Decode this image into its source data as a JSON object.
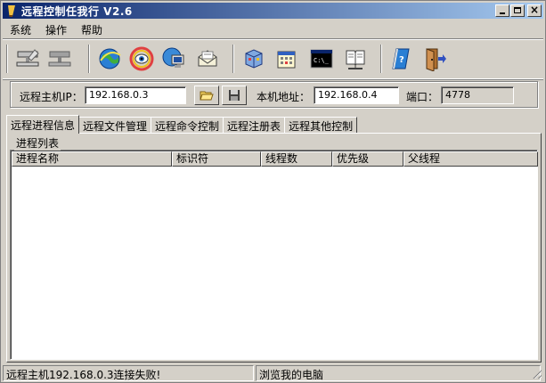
{
  "window": {
    "title": "远程控制任我行  V2.6"
  },
  "menu": [
    {
      "label": "系统"
    },
    {
      "label": "操作"
    },
    {
      "label": "帮助"
    }
  ],
  "toolbar": {
    "buttons": [
      {
        "name": "connect-icon"
      },
      {
        "name": "disconnect-icon"
      },
      {
        "name": "globe-icon"
      },
      {
        "name": "eye-icon"
      },
      {
        "name": "network-screen-icon"
      },
      {
        "name": "mail-icon"
      },
      {
        "name": "registry-cube-icon"
      },
      {
        "name": "calendar-icon"
      },
      {
        "name": "command-prompt-icon"
      },
      {
        "name": "book-network-icon"
      },
      {
        "name": "help-book-icon"
      },
      {
        "name": "exit-door-icon"
      }
    ]
  },
  "connection": {
    "remote_ip_label": "远程主机IP：",
    "remote_ip_value": "192.168.0.3",
    "local_addr_label": "本机地址：",
    "local_addr_value": "192.168.0.4",
    "port_label": "端口：",
    "port_value": "4778"
  },
  "tabs": [
    {
      "label": "远程进程信息",
      "active": true
    },
    {
      "label": "远程文件管理"
    },
    {
      "label": "远程命令控制"
    },
    {
      "label": "远程注册表"
    },
    {
      "label": "远程其他控制"
    }
  ],
  "process_panel": {
    "caption": "进程列表",
    "columns": [
      "进程名称",
      "标识符",
      "线程数",
      "优先级",
      "父线程"
    ]
  },
  "status": {
    "left": "远程主机192.168.0.3连接失败!",
    "middle": "浏览我的电脑"
  }
}
